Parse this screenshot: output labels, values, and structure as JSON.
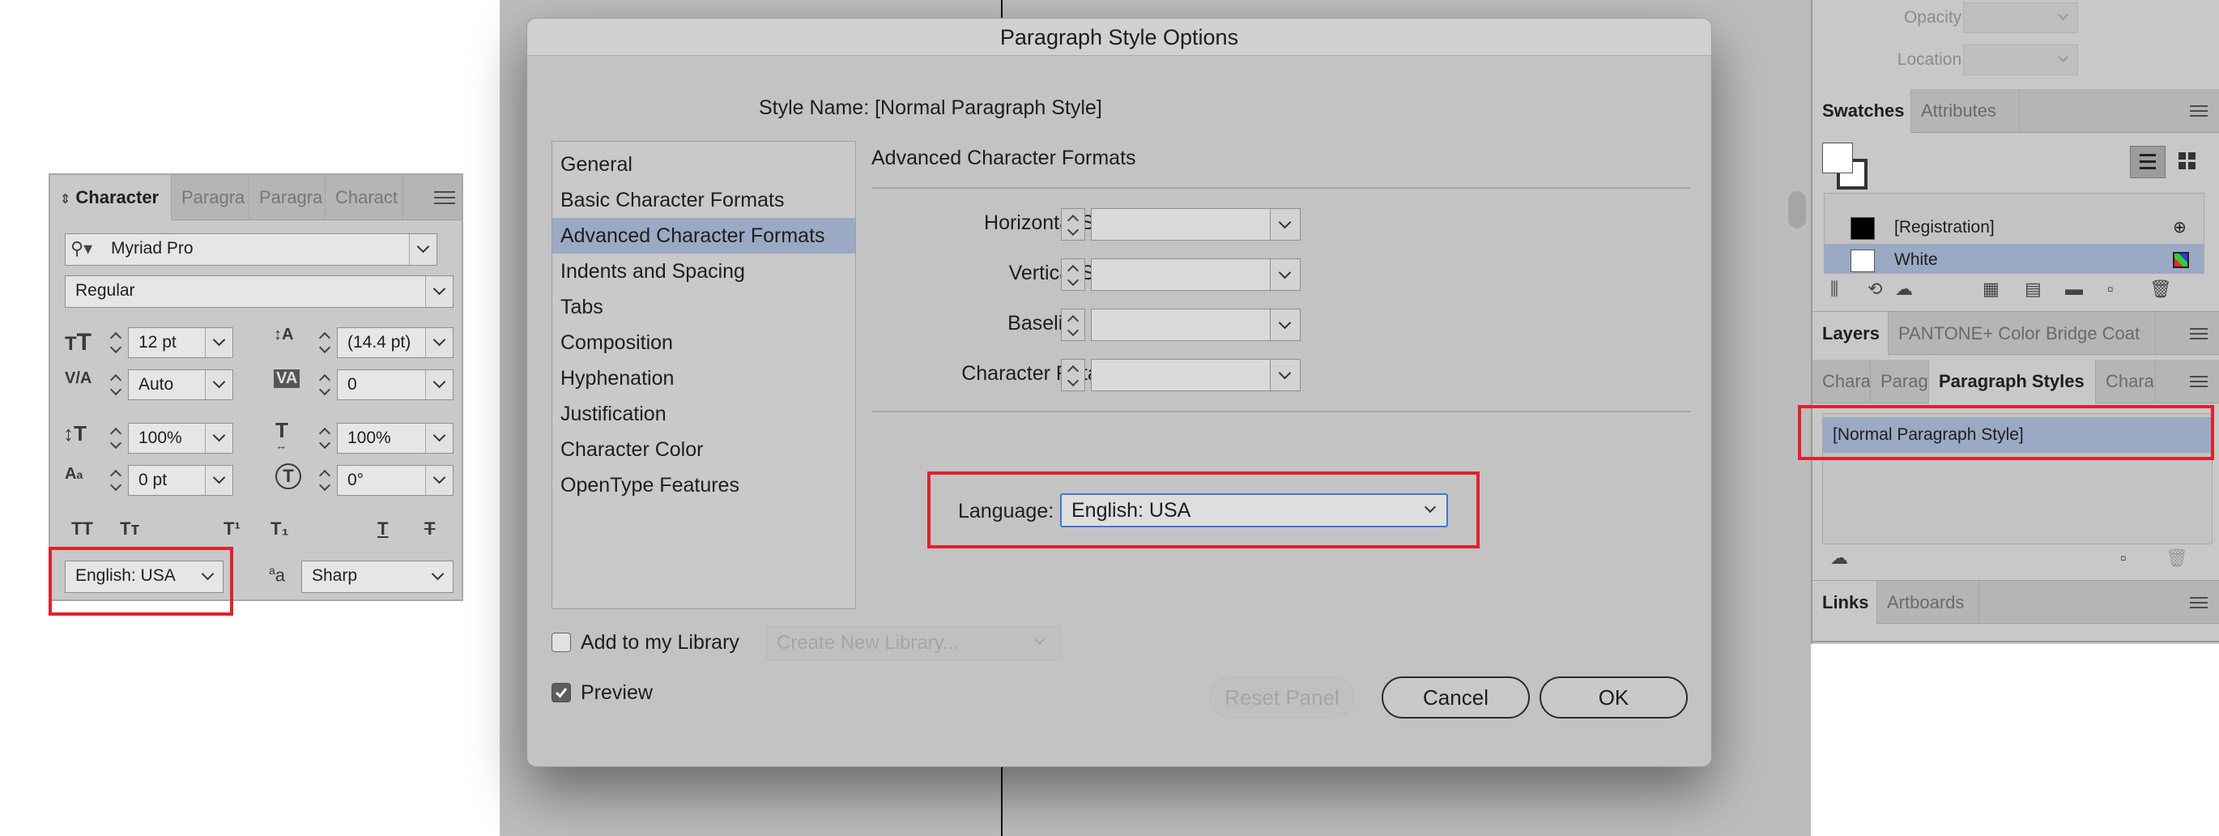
{
  "character_panel": {
    "tabs": [
      "Character",
      "Paragra",
      "Paragra",
      "Charact"
    ],
    "font_family": "Myriad Pro",
    "font_style": "Regular",
    "font_size": "12 pt",
    "leading": "(14.4 pt)",
    "kerning": "Auto",
    "tracking": "0",
    "vertical_scale": "100%",
    "horizontal_scale": "100%",
    "baseline_shift": "0 pt",
    "skew": "0°",
    "language": "English: USA",
    "antialias": "Sharp",
    "format_buttons": [
      "TT",
      "Tт",
      "T¹",
      "T₁",
      "T",
      "T"
    ]
  },
  "dialog": {
    "title": "Paragraph Style Options",
    "style_name": "Style Name: [Normal Paragraph Style]",
    "categories": [
      "General",
      "Basic Character Formats",
      "Advanced Character Formats",
      "Indents and Spacing",
      "Tabs",
      "Composition",
      "Hyphenation",
      "Justification",
      "Character Color",
      "OpenType Features"
    ],
    "selected_category": "Advanced Character Formats",
    "section_title": "Advanced Character Formats",
    "fields": [
      "Horizontal Scale:",
      "Vertical Scale:",
      "Baseline Shift:",
      "Character Rotation:"
    ],
    "language_label": "Language:",
    "language_value": "English: USA",
    "add_library_label": "Add to my Library",
    "library_placeholder": "Create New Library...",
    "preview_label": "Preview",
    "reset_button": "Reset Panel",
    "cancel_button": "Cancel",
    "ok_button": "OK"
  },
  "right_panel": {
    "opacity_label": "Opacity:",
    "location_label": "Location:",
    "swatch_tabs": [
      "Swatches",
      "Attributes"
    ],
    "swatches": [
      "[Registration]",
      "White"
    ],
    "layer_tabs": [
      "Layers",
      "PANTONE+ Color Bridge Coat"
    ],
    "style_tabs": [
      "Chara",
      "Parag",
      "Paragraph Styles",
      "Chara"
    ],
    "paragraph_styles": [
      "[Normal Paragraph Style]"
    ],
    "link_tabs": [
      "Links",
      "Artboards"
    ]
  },
  "colors": {
    "highlight": "#e0212e",
    "selection": "#9aa9c4",
    "focus": "#3f78d0"
  }
}
